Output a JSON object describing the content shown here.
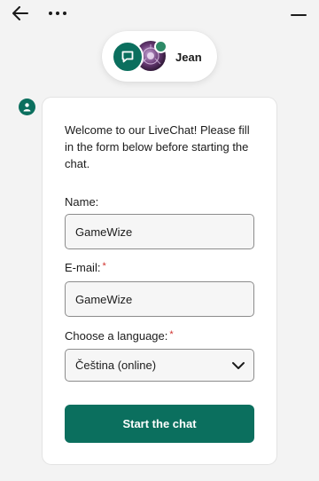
{
  "header": {
    "back_icon": "arrow-left-icon",
    "more_icon": "more-horizontal-icon",
    "minimize_icon": "minimize-icon"
  },
  "agent": {
    "name": "Jean",
    "status": "online",
    "logo_icon": "chat-bubble-icon"
  },
  "form": {
    "welcome_text": "Welcome to our LiveChat! Please fill in the form below before starting the chat.",
    "name_label": "Name:",
    "name_value": "GameWize",
    "email_label": "E-mail:",
    "email_value": "GameWize",
    "language_label": "Choose a language:",
    "language_value": "Čeština (online)",
    "required_mark": "*",
    "submit_label": "Start the chat"
  },
  "colors": {
    "brand": "#0b6f5e",
    "required": "#d0312d",
    "online": "#2e8a67"
  }
}
